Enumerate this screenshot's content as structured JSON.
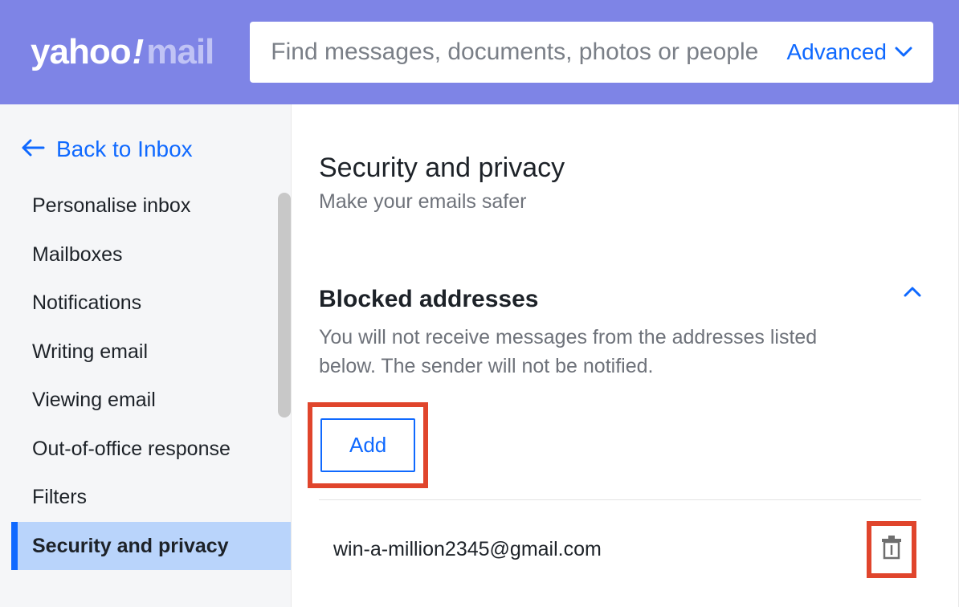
{
  "logo": {
    "brand": "yahoo",
    "bang": "!",
    "product": "mail"
  },
  "search": {
    "placeholder": "Find messages, documents, photos or people",
    "advanced_label": "Advanced"
  },
  "sidebar": {
    "back_label": "Back to Inbox",
    "items": [
      {
        "label": "Personalise inbox",
        "active": false
      },
      {
        "label": "Mailboxes",
        "active": false
      },
      {
        "label": "Notifications",
        "active": false
      },
      {
        "label": "Writing email",
        "active": false
      },
      {
        "label": "Viewing email",
        "active": false
      },
      {
        "label": "Out-of-office response",
        "active": false
      },
      {
        "label": "Filters",
        "active": false
      },
      {
        "label": "Security and privacy",
        "active": true
      }
    ]
  },
  "main": {
    "title": "Security and privacy",
    "subtitle": "Make your emails safer",
    "section": {
      "title": "Blocked addresses",
      "description": "You will not receive messages from the addresses listed below. The sender will not be notified.",
      "add_label": "Add",
      "blocked": [
        {
          "email": "win-a-million2345@gmail.com"
        }
      ]
    }
  },
  "colors": {
    "accent": "#0f69ff",
    "header_bg": "#7e84e6",
    "highlight_border": "#e0452c"
  }
}
